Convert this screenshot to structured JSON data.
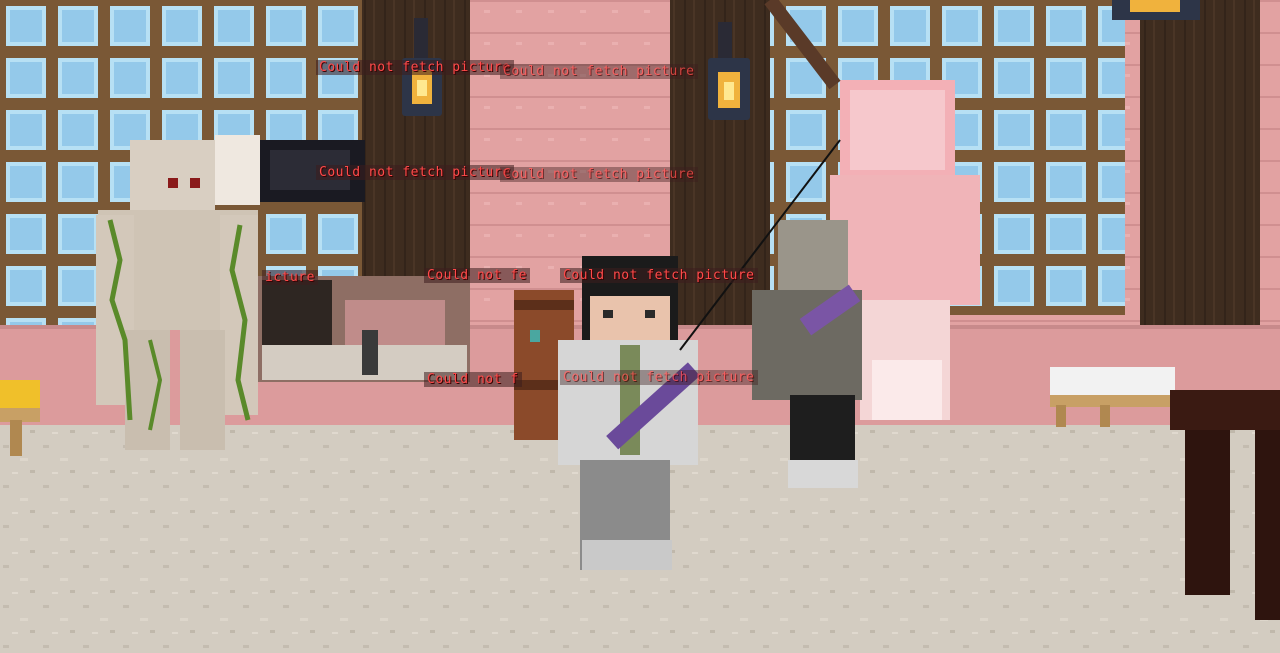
{
  "overlay": {
    "error_text": "Could not fetch picture",
    "error_partial_1": "Could not fe",
    "error_partial_2": "icture",
    "error_partial_3": "Could not f",
    "error_partial_4": "Could not fetch picture"
  },
  "scene": {
    "floor_color": "#cfc8bd",
    "wall_pink": "#e3a3a4",
    "wall_dark": "#3b2a1f",
    "window_glass": "#9fd0ee",
    "window_frame": "#7a5836"
  }
}
